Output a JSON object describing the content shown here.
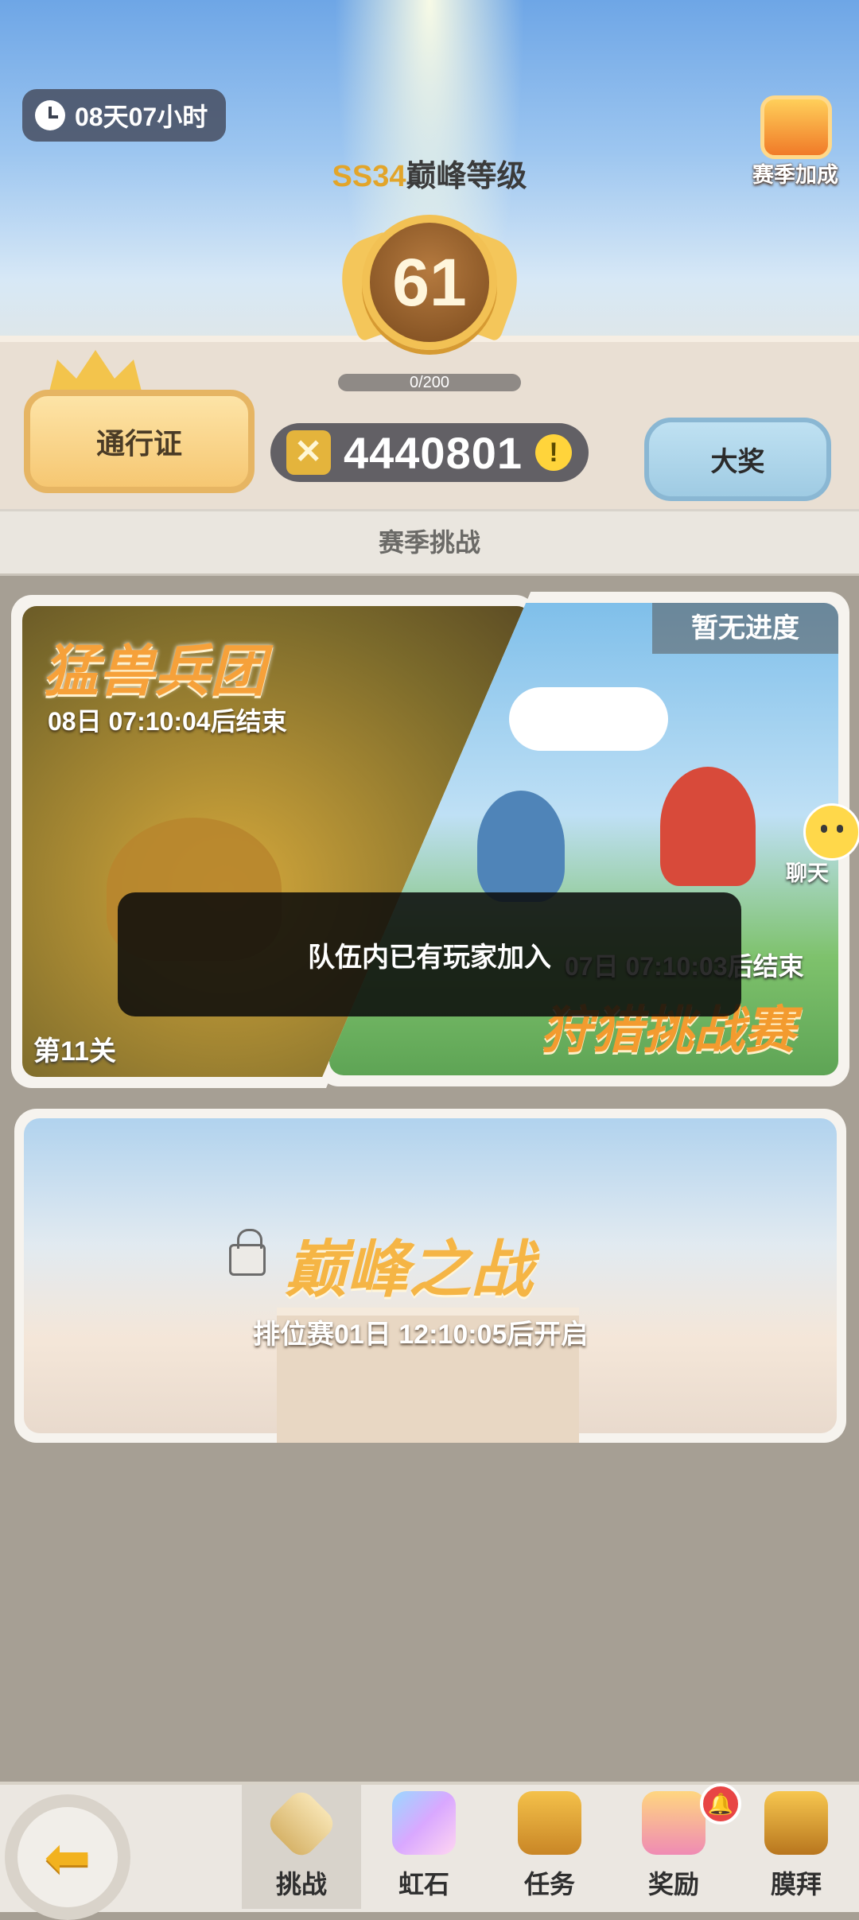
{
  "header": {
    "timer": "08天07小时",
    "season_prefix": "SS34",
    "season_title": "巅峰等级",
    "rank_level": "61",
    "progress": "0/200",
    "points": "4440801",
    "pass_label": "通行证",
    "prize_label": "大奖",
    "boost_label": "赛季加成"
  },
  "section_title": "赛季挑战",
  "events": [
    {
      "title": "猛兽兵团",
      "timer": "08日 07:10:04后结束",
      "stage": "第11关"
    },
    {
      "title": "狩猎挑战赛",
      "timer": "07日 07:10:03后结束",
      "status": "暂无进度"
    }
  ],
  "peak": {
    "title": "巅峰之战",
    "subtitle": "排位赛01日 12:10:05后开启"
  },
  "chat_label": "聊天",
  "toast": "队伍内已有玩家加入",
  "nav": {
    "items": [
      "挑战",
      "虹石",
      "任务",
      "奖励",
      "膜拜"
    ],
    "active": "挑战"
  },
  "icons": {
    "back": "back-arrow-icon",
    "clock": "clock-icon",
    "lock": "lock-icon",
    "points": "crossed-swords-icon",
    "info": "info-icon",
    "bell": "notification-bell-icon"
  },
  "colors": {
    "accent": "#f5b545",
    "toast_bg": "#111111",
    "nav_active": "#d8d3cb"
  }
}
